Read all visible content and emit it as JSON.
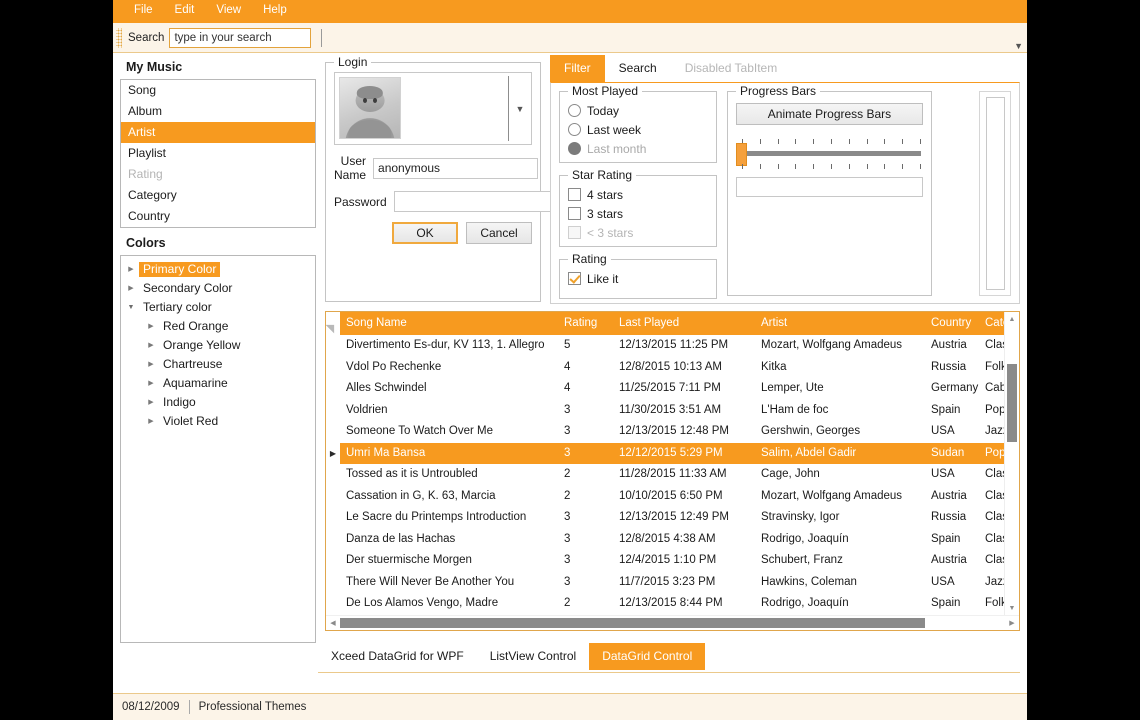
{
  "menu": {
    "items": [
      "File",
      "Edit",
      "View",
      "Help"
    ]
  },
  "toolbar": {
    "search_label": "Search",
    "search_value": "type in your search",
    "search_placeholder": "type in your search",
    "overflow_icon": "chevron-down-icon"
  },
  "left": {
    "my_music_title": "My Music",
    "listbox": [
      {
        "label": "Song",
        "state": "normal"
      },
      {
        "label": "Album",
        "state": "normal"
      },
      {
        "label": "Artist",
        "state": "selected"
      },
      {
        "label": "Playlist",
        "state": "normal"
      },
      {
        "label": "Rating",
        "state": "disabled"
      },
      {
        "label": "Category",
        "state": "normal"
      },
      {
        "label": "Country",
        "state": "normal"
      }
    ],
    "colors_title": "Colors",
    "tree": [
      {
        "label": "Primary Color",
        "expanded": false,
        "selected": true,
        "level": 0
      },
      {
        "label": "Secondary Color",
        "expanded": false,
        "selected": false,
        "level": 0
      },
      {
        "label": "Tertiary color",
        "expanded": true,
        "selected": false,
        "level": 0
      },
      {
        "label": "Red Orange",
        "expanded": false,
        "selected": false,
        "level": 1
      },
      {
        "label": "Orange Yellow",
        "expanded": false,
        "selected": false,
        "level": 1
      },
      {
        "label": "Chartreuse",
        "expanded": false,
        "selected": false,
        "level": 1
      },
      {
        "label": "Aquamarine",
        "expanded": false,
        "selected": false,
        "level": 1
      },
      {
        "label": "Indigo",
        "expanded": false,
        "selected": false,
        "level": 1
      },
      {
        "label": "Violet Red",
        "expanded": false,
        "selected": false,
        "level": 1
      }
    ]
  },
  "login": {
    "legend": "Login",
    "avatar_icon": "user-avatar-image",
    "combo_arrow_icon": "chevron-down-icon",
    "username_label": "User Name",
    "username_value": "anonymous",
    "password_label": "Password",
    "password_value": "",
    "ok_label": "OK",
    "cancel_label": "Cancel"
  },
  "tabs": {
    "items": [
      {
        "label": "Filter",
        "state": "active"
      },
      {
        "label": "Search",
        "state": "normal"
      },
      {
        "label": "Disabled TabItem",
        "state": "disabled"
      }
    ]
  },
  "filter_panel": {
    "most_played": {
      "legend": "Most Played",
      "options": [
        {
          "label": "Today",
          "checked": false,
          "disabled": false
        },
        {
          "label": "Last week",
          "checked": false,
          "disabled": false
        },
        {
          "label": "Last month",
          "checked": true,
          "disabled": true
        }
      ]
    },
    "star_rating": {
      "legend": "Star Rating",
      "options": [
        {
          "label": "4 stars",
          "checked": false,
          "disabled": false
        },
        {
          "label": "3 stars",
          "checked": false,
          "disabled": false
        },
        {
          "label": "< 3 stars",
          "checked": false,
          "disabled": true
        }
      ]
    },
    "rating": {
      "legend": "Rating",
      "options": [
        {
          "label": "Like it",
          "checked": true,
          "disabled": false
        }
      ]
    },
    "progress": {
      "legend": "Progress Bars",
      "animate_label": "Animate Progress Bars",
      "slider_value": 0,
      "slider_tick_count": 11,
      "horizontal_bar_value": 0,
      "vertical_bar_value": 0
    }
  },
  "grid": {
    "columns": [
      "Song Name",
      "Rating",
      "Last Played",
      "Artist",
      "Country",
      "Category"
    ],
    "rows": [
      {
        "song": "Divertimento Es-dur, KV 113, 1. Allegro",
        "rating": "5",
        "last": "12/13/2015 11:25 PM",
        "artist": "Mozart, Wolfgang Amadeus",
        "country": "Austria",
        "category": "Classical",
        "selected": false
      },
      {
        "song": "Vdol Po Rechenke",
        "rating": "4",
        "last": "12/8/2015 10:13 AM",
        "artist": "Kitka",
        "country": "Russia",
        "category": "Folk",
        "selected": false
      },
      {
        "song": "Alles Schwindel",
        "rating": "4",
        "last": "11/25/2015 7:11 PM",
        "artist": "Lemper, Ute",
        "country": "Germany",
        "category": "Cabaret",
        "selected": false
      },
      {
        "song": "Voldrien",
        "rating": "3",
        "last": "11/30/2015 3:51 AM",
        "artist": "L'Ham de foc",
        "country": "Spain",
        "category": "Pop",
        "selected": false
      },
      {
        "song": "Someone To Watch Over Me",
        "rating": "3",
        "last": "12/13/2015 12:48 PM",
        "artist": "Gershwin, Georges",
        "country": "USA",
        "category": "Jazz",
        "selected": false
      },
      {
        "song": "Umri Ma Bansa",
        "rating": "3",
        "last": "12/12/2015 5:29 PM",
        "artist": "Salim, Abdel Gadir",
        "country": "Sudan",
        "category": "Pop",
        "selected": true
      },
      {
        "song": "Tossed as it is Untroubled",
        "rating": "2",
        "last": "11/28/2015 11:33 AM",
        "artist": "Cage, John",
        "country": "USA",
        "category": "Classical",
        "selected": false
      },
      {
        "song": "Cassation in G, K. 63, Marcia",
        "rating": "2",
        "last": "10/10/2015 6:50 PM",
        "artist": "Mozart, Wolfgang Amadeus",
        "country": "Austria",
        "category": "Classical",
        "selected": false
      },
      {
        "song": "Le Sacre du Printemps Introduction",
        "rating": "3",
        "last": "12/13/2015 12:49 PM",
        "artist": "Stravinsky, Igor",
        "country": "Russia",
        "category": "Classical",
        "selected": false
      },
      {
        "song": "Danza de las Hachas",
        "rating": "3",
        "last": "12/8/2015 4:38 AM",
        "artist": "Rodrigo, Joaquín",
        "country": "Spain",
        "category": "Classical",
        "selected": false
      },
      {
        "song": "Der stuermische Morgen",
        "rating": "3",
        "last": "12/4/2015 1:10 PM",
        "artist": "Schubert, Franz",
        "country": "Austria",
        "category": "Classical",
        "selected": false
      },
      {
        "song": "There Will Never Be Another You",
        "rating": "3",
        "last": "11/7/2015 3:23 PM",
        "artist": "Hawkins, Coleman",
        "country": "USA",
        "category": "Jazz",
        "selected": false
      },
      {
        "song": "De Los Alamos Vengo, Madre",
        "rating": "2",
        "last": "12/13/2015 8:44 PM",
        "artist": "Rodrigo, Joaquín",
        "country": "Spain",
        "category": "Folk",
        "selected": false
      }
    ]
  },
  "bottom_tabs": {
    "items": [
      {
        "label": "Xceed DataGrid for WPF",
        "state": "normal"
      },
      {
        "label": "ListView Control",
        "state": "normal"
      },
      {
        "label": "DataGrid Control",
        "state": "active"
      }
    ]
  },
  "status": {
    "date": "08/12/2009",
    "theme": "Professional Themes"
  },
  "colors": {
    "accent": "#F79A1F",
    "accent_light": "#FCF4E8",
    "accent_border": "#EBC98B",
    "text": "#1b1b1b",
    "disabled_text": "#b4b4b4"
  }
}
